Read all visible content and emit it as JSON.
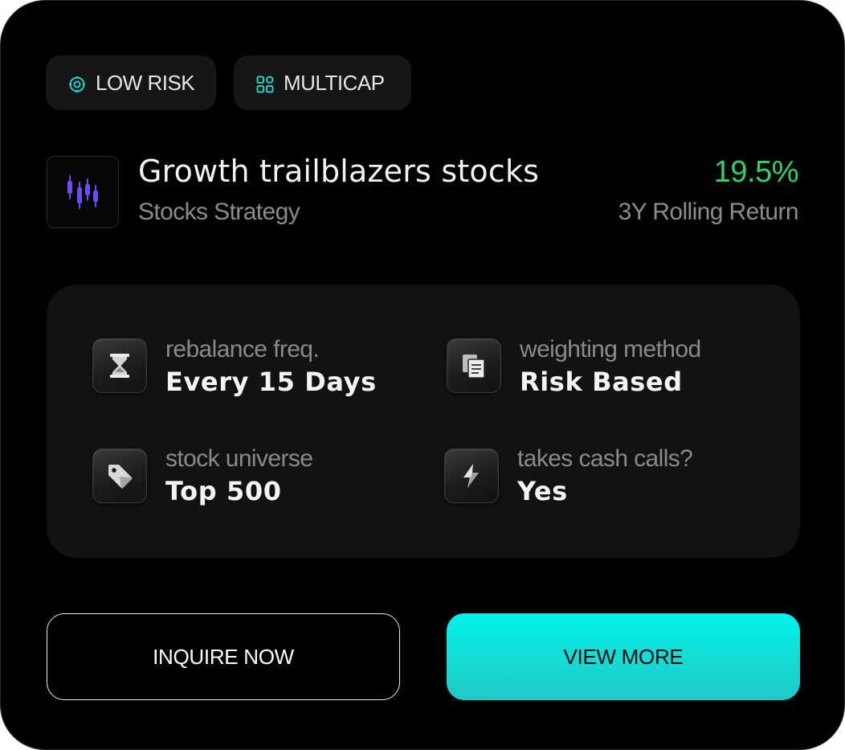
{
  "tags": {
    "risk": {
      "label": "LOW RISK",
      "icon": "target-icon"
    },
    "cap": {
      "label": "MULTICAP",
      "icon": "grid-icon"
    }
  },
  "strategy": {
    "logo_icon": "candlestick-chart-icon",
    "title": "Growth trailblazers stocks",
    "subtitle": "Stocks Strategy",
    "return_value": "19.5%",
    "return_label": "3Y Rolling Return"
  },
  "details": {
    "rebalance": {
      "label": "rebalance freq.",
      "value": "Every 15 Days",
      "icon": "hourglass-icon"
    },
    "weighting": {
      "label": "weighting method",
      "value": "Risk Based",
      "icon": "documents-icon"
    },
    "universe": {
      "label": "stock universe",
      "value": "Top 500",
      "icon": "price-tag-icon"
    },
    "cash_calls": {
      "label": "takes cash calls?",
      "value": "Yes",
      "icon": "lightning-bolt-icon"
    }
  },
  "actions": {
    "inquire_label": "INQUIRE NOW",
    "view_more_label": "VIEW MORE"
  },
  "colors": {
    "background": "#000000",
    "accent_teal": "#00f3ea",
    "return_green": "#2fd26a",
    "logo_purple": "#6c4cf0"
  }
}
